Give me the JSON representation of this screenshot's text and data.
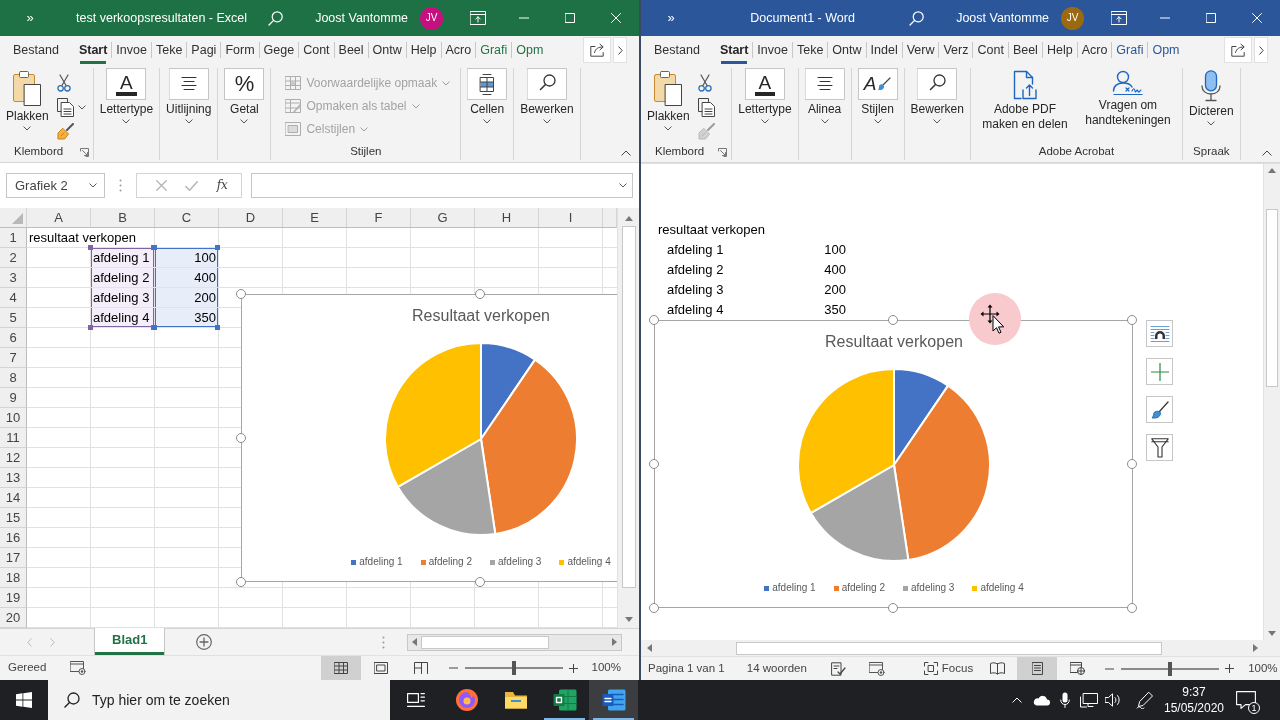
{
  "excel": {
    "title_bar": {
      "quick_access": "»",
      "title": "test verkoopsresultaten - Excel",
      "user": "Joost Vantomme",
      "avatar": "JV"
    },
    "tabs": [
      {
        "label": "Bestand",
        "selected": false,
        "kind": "standard"
      },
      {
        "label": "Start",
        "selected": true,
        "kind": "standard"
      },
      {
        "label": "Invoe",
        "selected": false,
        "kind": "standard"
      },
      {
        "label": "Teke",
        "selected": false,
        "kind": "standard"
      },
      {
        "label": "Pagi",
        "selected": false,
        "kind": "standard"
      },
      {
        "label": "Form",
        "selected": false,
        "kind": "standard"
      },
      {
        "label": "Gege",
        "selected": false,
        "kind": "standard"
      },
      {
        "label": "Cont",
        "selected": false,
        "kind": "standard"
      },
      {
        "label": "Beel",
        "selected": false,
        "kind": "standard"
      },
      {
        "label": "Ontw",
        "selected": false,
        "kind": "standard"
      },
      {
        "label": "Help",
        "selected": false,
        "kind": "standard"
      },
      {
        "label": "Acro",
        "selected": false,
        "kind": "standard"
      },
      {
        "label": "Grafi",
        "selected": false,
        "kind": "contextual"
      },
      {
        "label": "Opm",
        "selected": false,
        "kind": "contextual"
      }
    ],
    "ribbon": [
      {
        "label": "Klembord",
        "launcher": true,
        "items": [
          {
            "kind": "large",
            "label": "Plakken",
            "dropdown": true,
            "disabled": false
          },
          {
            "kind": "small",
            "dropdown": false,
            "disabled": false
          },
          {
            "kind": "small",
            "dropdown": true,
            "disabled": false
          },
          {
            "kind": "small",
            "dropdown": false,
            "disabled": false
          }
        ]
      },
      {
        "launcher": false,
        "items": [
          {
            "kind": "boxed",
            "label": "Lettertype",
            "glyph": "A",
            "dropdown": true,
            "disabled": false
          }
        ]
      },
      {
        "launcher": false,
        "items": [
          {
            "kind": "boxed",
            "label": "Uitlijning",
            "dropdown": true,
            "disabled": false
          }
        ]
      },
      {
        "launcher": false,
        "items": [
          {
            "kind": "boxed",
            "label": "Getal",
            "glyph": "%",
            "dropdown": true,
            "disabled": false
          }
        ]
      },
      {
        "label": "Stijlen",
        "launcher": false,
        "items": [
          {
            "kind": "row",
            "label": "Voorwaardelijke opmaak",
            "dropdown": true,
            "disabled": true
          },
          {
            "kind": "row",
            "label": "Opmaken als tabel",
            "dropdown": true,
            "disabled": true
          },
          {
            "kind": "row",
            "label": "Celstijlen",
            "dropdown": true,
            "disabled": true
          }
        ]
      },
      {
        "launcher": false,
        "items": [
          {
            "kind": "boxed",
            "label": "Cellen",
            "dropdown": true,
            "disabled": false
          }
        ]
      },
      {
        "launcher": false,
        "items": [
          {
            "kind": "boxed",
            "label": "Bewerken",
            "dropdown": true,
            "disabled": false
          }
        ]
      }
    ],
    "formula_bar": {
      "name_box": "Grafiek 2",
      "function_label": "fx"
    },
    "sheet": {
      "columns": [
        "A",
        "B",
        "C",
        "D",
        "E",
        "F",
        "G",
        "H",
        "I"
      ],
      "rows": [
        {
          "header": "1",
          "cells": [
            {
              "text": "resultaat verkopen",
              "kind": "text",
              "highlighted": false
            }
          ]
        },
        {
          "header": "2",
          "cells": [
            null,
            {
              "text": "afdeling 1",
              "kind": "text",
              "highlighted": true
            },
            {
              "text": "100",
              "kind": "number",
              "highlighted": true
            }
          ]
        },
        {
          "header": "3",
          "cells": [
            null,
            {
              "text": "afdeling 2",
              "kind": "text",
              "highlighted": true
            },
            {
              "text": "400",
              "kind": "number",
              "highlighted": true
            }
          ]
        },
        {
          "header": "4",
          "cells": [
            null,
            {
              "text": "afdeling 3",
              "kind": "text",
              "highlighted": true
            },
            {
              "text": "200",
              "kind": "number",
              "highlighted": true
            }
          ]
        },
        {
          "header": "5",
          "cells": [
            null,
            {
              "text": "afdeling 4",
              "kind": "text",
              "highlighted": true
            },
            {
              "text": "350",
              "kind": "number",
              "highlighted": true
            }
          ]
        },
        {
          "header": "6"
        },
        {
          "header": "7"
        },
        {
          "header": "8"
        },
        {
          "header": "9"
        },
        {
          "header": "10"
        },
        {
          "header": "11"
        },
        {
          "header": "12"
        },
        {
          "header": "13"
        },
        {
          "header": "14"
        },
        {
          "header": "15"
        },
        {
          "header": "16"
        },
        {
          "header": "17"
        },
        {
          "header": "18"
        },
        {
          "header": "19"
        },
        {
          "header": "20"
        }
      ]
    },
    "chart": {
      "selected": true,
      "chart_data": {
        "type": "pie",
        "title": "Resultaat verkopen",
        "categories": [
          "afdeling 1",
          "afdeling 2",
          "afdeling 3",
          "afdeling 4"
        ],
        "values": [
          9.52,
          38.1,
          19.05,
          33.33
        ],
        "colors": [
          "#4472c4",
          "#ed7d31",
          "#a5a5a5",
          "#ffc000"
        ],
        "legend": "bottom"
      }
    },
    "sheet_tabs": [
      {
        "label": "Blad1",
        "selected": true
      }
    ],
    "status_bar": {
      "status": "Gereed",
      "views": [
        {
          "selected": true
        },
        {
          "selected": false
        },
        {
          "selected": false
        }
      ],
      "zoom": {
        "level": 0.5,
        "reading": "100%"
      }
    }
  },
  "word": {
    "title_bar": {
      "quick_access": "»",
      "title": "Document1 - Word",
      "user": "Joost Vantomme",
      "avatar": "JV"
    },
    "tabs": [
      {
        "label": "Bestand",
        "selected": false,
        "kind": "standard"
      },
      {
        "label": "Start",
        "selected": true,
        "kind": "standard"
      },
      {
        "label": "Invoe",
        "selected": false,
        "kind": "standard"
      },
      {
        "label": "Teke",
        "selected": false,
        "kind": "standard"
      },
      {
        "label": "Ontw",
        "selected": false,
        "kind": "standard"
      },
      {
        "label": "Indel",
        "selected": false,
        "kind": "standard"
      },
      {
        "label": "Verw",
        "selected": false,
        "kind": "standard"
      },
      {
        "label": "Verz",
        "selected": false,
        "kind": "standard"
      },
      {
        "label": "Cont",
        "selected": false,
        "kind": "standard"
      },
      {
        "label": "Beel",
        "selected": false,
        "kind": "standard"
      },
      {
        "label": "Help",
        "selected": false,
        "kind": "standard"
      },
      {
        "label": "Acro",
        "selected": false,
        "kind": "standard"
      },
      {
        "label": "Grafi",
        "selected": false,
        "kind": "contextual"
      },
      {
        "label": "Opm",
        "selected": false,
        "kind": "contextual"
      }
    ],
    "ribbon": [
      {
        "label": "Klembord",
        "launcher": true,
        "items": [
          {
            "kind": "large",
            "label": "Plakken",
            "dropdown": true,
            "disabled": false
          },
          {
            "kind": "small",
            "dropdown": false,
            "disabled": false
          },
          {
            "kind": "small",
            "dropdown": false,
            "disabled": false
          },
          {
            "kind": "small",
            "dropdown": false,
            "disabled": true
          }
        ]
      },
      {
        "launcher": false,
        "items": [
          {
            "kind": "boxed",
            "label": "Lettertype",
            "glyph": "A",
            "dropdown": true,
            "disabled": false
          }
        ]
      },
      {
        "launcher": false,
        "items": [
          {
            "kind": "boxed",
            "label": "Alinea",
            "dropdown": true,
            "disabled": false
          }
        ]
      },
      {
        "launcher": false,
        "items": [
          {
            "kind": "boxed",
            "label": "Stijlen",
            "glyph": "A",
            "dropdown": true,
            "disabled": false
          }
        ]
      },
      {
        "launcher": false,
        "items": [
          {
            "kind": "boxed",
            "label": "Bewerken",
            "dropdown": true,
            "disabled": false
          }
        ]
      },
      {
        "label": "Adobe Acrobat",
        "launcher": false,
        "items": [
          {
            "kind": "large",
            "label": "Adobe PDF maken en delen",
            "dropdown": false,
            "disabled": false
          },
          {
            "kind": "large",
            "label": "Vragen om handtekeningen",
            "dropdown": false,
            "disabled": false
          }
        ]
      },
      {
        "label": "Spraak",
        "launcher": false,
        "items": [
          {
            "kind": "large",
            "label": "Dicteren",
            "dropdown": true,
            "disabled": false
          }
        ]
      }
    ],
    "document": {
      "paragraph": "resultaat verkopen",
      "table": [
        {
          "label": "afdeling 1",
          "value": "100"
        },
        {
          "label": "afdeling 2",
          "value": "400"
        },
        {
          "label": "afdeling 3",
          "value": "200"
        },
        {
          "label": "afdeling 4",
          "value": "350"
        }
      ]
    },
    "chart": {
      "selected": true,
      "chart_data": {
        "type": "pie",
        "title": "Resultaat verkopen",
        "categories": [
          "afdeling 1",
          "afdeling 2",
          "afdeling 3",
          "afdeling 4"
        ],
        "values": [
          9.52,
          38.1,
          19.05,
          33.33
        ],
        "colors": [
          "#4472c4",
          "#ed7d31",
          "#a5a5a5",
          "#ffc000"
        ],
        "legend": "bottom"
      }
    },
    "status_bar": {
      "page": "Pagina 1 van 1",
      "word_count": "14 woorden",
      "focus": "Focus",
      "views": [
        {
          "selected": false
        },
        {
          "selected": true
        },
        {
          "selected": false
        }
      ],
      "zoom": {
        "level": 0.5,
        "reading": "100%"
      }
    }
  },
  "taskbar": {
    "search": {
      "placeholder": "Typ hier om te zoeken"
    },
    "apps": [
      {
        "running": false,
        "active": false
      },
      {
        "running": false,
        "active": false
      },
      {
        "running": true,
        "active": false
      },
      {
        "running": true,
        "active": true
      }
    ],
    "clock": {
      "time": "9:37",
      "date": "15/05/2020"
    },
    "notifications": "1"
  }
}
